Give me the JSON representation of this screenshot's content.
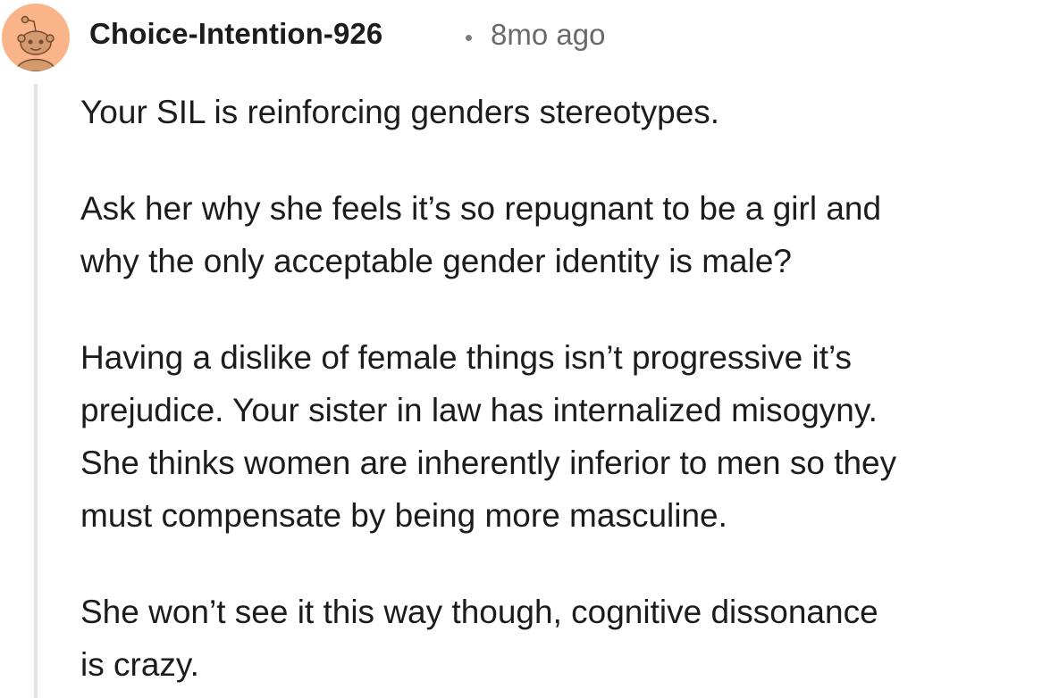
{
  "comment": {
    "author": "Choice-Intention-926",
    "separator": "•",
    "timestamp": "8mo ago",
    "avatar_icon": "snoo-avatar-icon",
    "avatar_color": "#f9b48a",
    "paragraphs": [
      "Your SIL is reinforcing genders stereotypes.",
      "Ask her why she feels it’s so repugnant to be a girl and\nwhy the only acceptable gender identity is male?",
      "Having a dislike of female things isn’t progressive it’s\nprejudice. Your sister in law has internalized misogyny.\nShe thinks women are inherently inferior to men so they\nmust compensate by being more masculine.",
      "She won’t see it this way though, cognitive dissonance\nis crazy."
    ]
  }
}
